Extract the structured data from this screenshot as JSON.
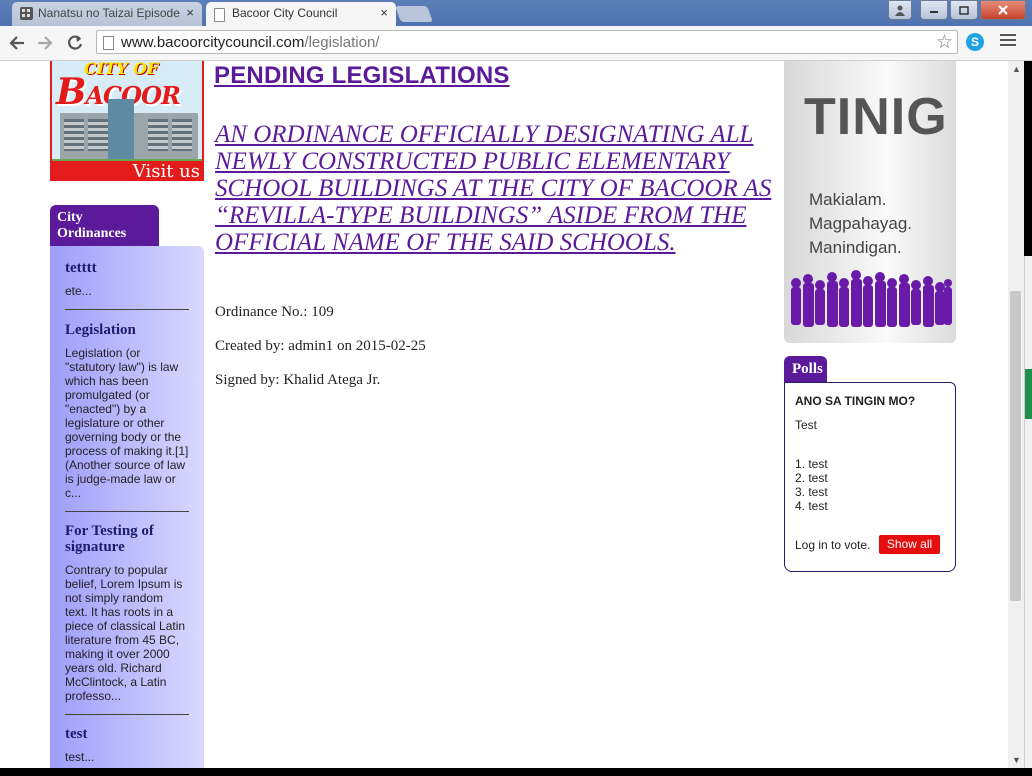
{
  "browser": {
    "tabs": [
      {
        "title": "Nanatsu no Taizai Episode",
        "active": false
      },
      {
        "title": "Bacoor City Council",
        "active": true
      }
    ],
    "url_host": "www.bacoorcitycouncil.com",
    "url_path": "/legislation/",
    "close_glyph": "×",
    "skype_label": "S"
  },
  "logo": {
    "line1": "CITY OF",
    "line2": "B",
    "line2_rest": "ACOOR",
    "visit": "Visit us"
  },
  "sidebar": {
    "tab_label": "City Ordinances",
    "items": [
      {
        "title": "tetttt",
        "excerpt": "ete..."
      },
      {
        "title": "Legislation",
        "excerpt": "Legislation (or \"statutory law\") is law which has been promulgated (or \"enacted\") by a legislature or other governing body or the process of making it.[1] (Another source of law is judge-made law or c..."
      },
      {
        "title": "For Testing of signature",
        "excerpt": "Contrary to popular belief, Lorem Ipsum is not simply random text. It has roots in a piece of classical Latin literature from 45 BC, making it over 2000 years old. Richard McClintock, a Latin professo..."
      },
      {
        "title": "test",
        "excerpt": "test..."
      }
    ]
  },
  "main": {
    "heading": "PENDING LEGISLATIONS",
    "ordinance_title": "AN ORDINANCE OFFICIALLY DESIGNATING ALL NEWLY CONSTRUCTED PUBLIC ELEMENTARY SCHOOL BUILDINGS AT THE CITY OF BACOOR AS “REVILLA-TYPE BUILDINGS” ASIDE FROM THE OFFICIAL NAME OF THE SAID SCHOOLS.",
    "ordinance_no": "Ordinance No.: 109",
    "created_by": "Created by: admin1 on 2015-02-25",
    "signed_by": "Signed by: Khalid Atega Jr."
  },
  "tinig": {
    "title": "TINIG",
    "lines": [
      "Makialam.",
      "Magpahayag.",
      "Manindigan."
    ],
    "crowd_color": "#6a1aa8"
  },
  "polls": {
    "tab_label": "Polls",
    "question": "ANO SA TINGIN MO?",
    "text": "Test",
    "options": [
      "1. test",
      "2. test",
      "3. test",
      "4. test"
    ],
    "login_text": "Log in to vote.",
    "show_all_label": "Show all"
  },
  "colors": {
    "brand_purple": "#5a1a99",
    "accent_red": "#e50f0f"
  }
}
